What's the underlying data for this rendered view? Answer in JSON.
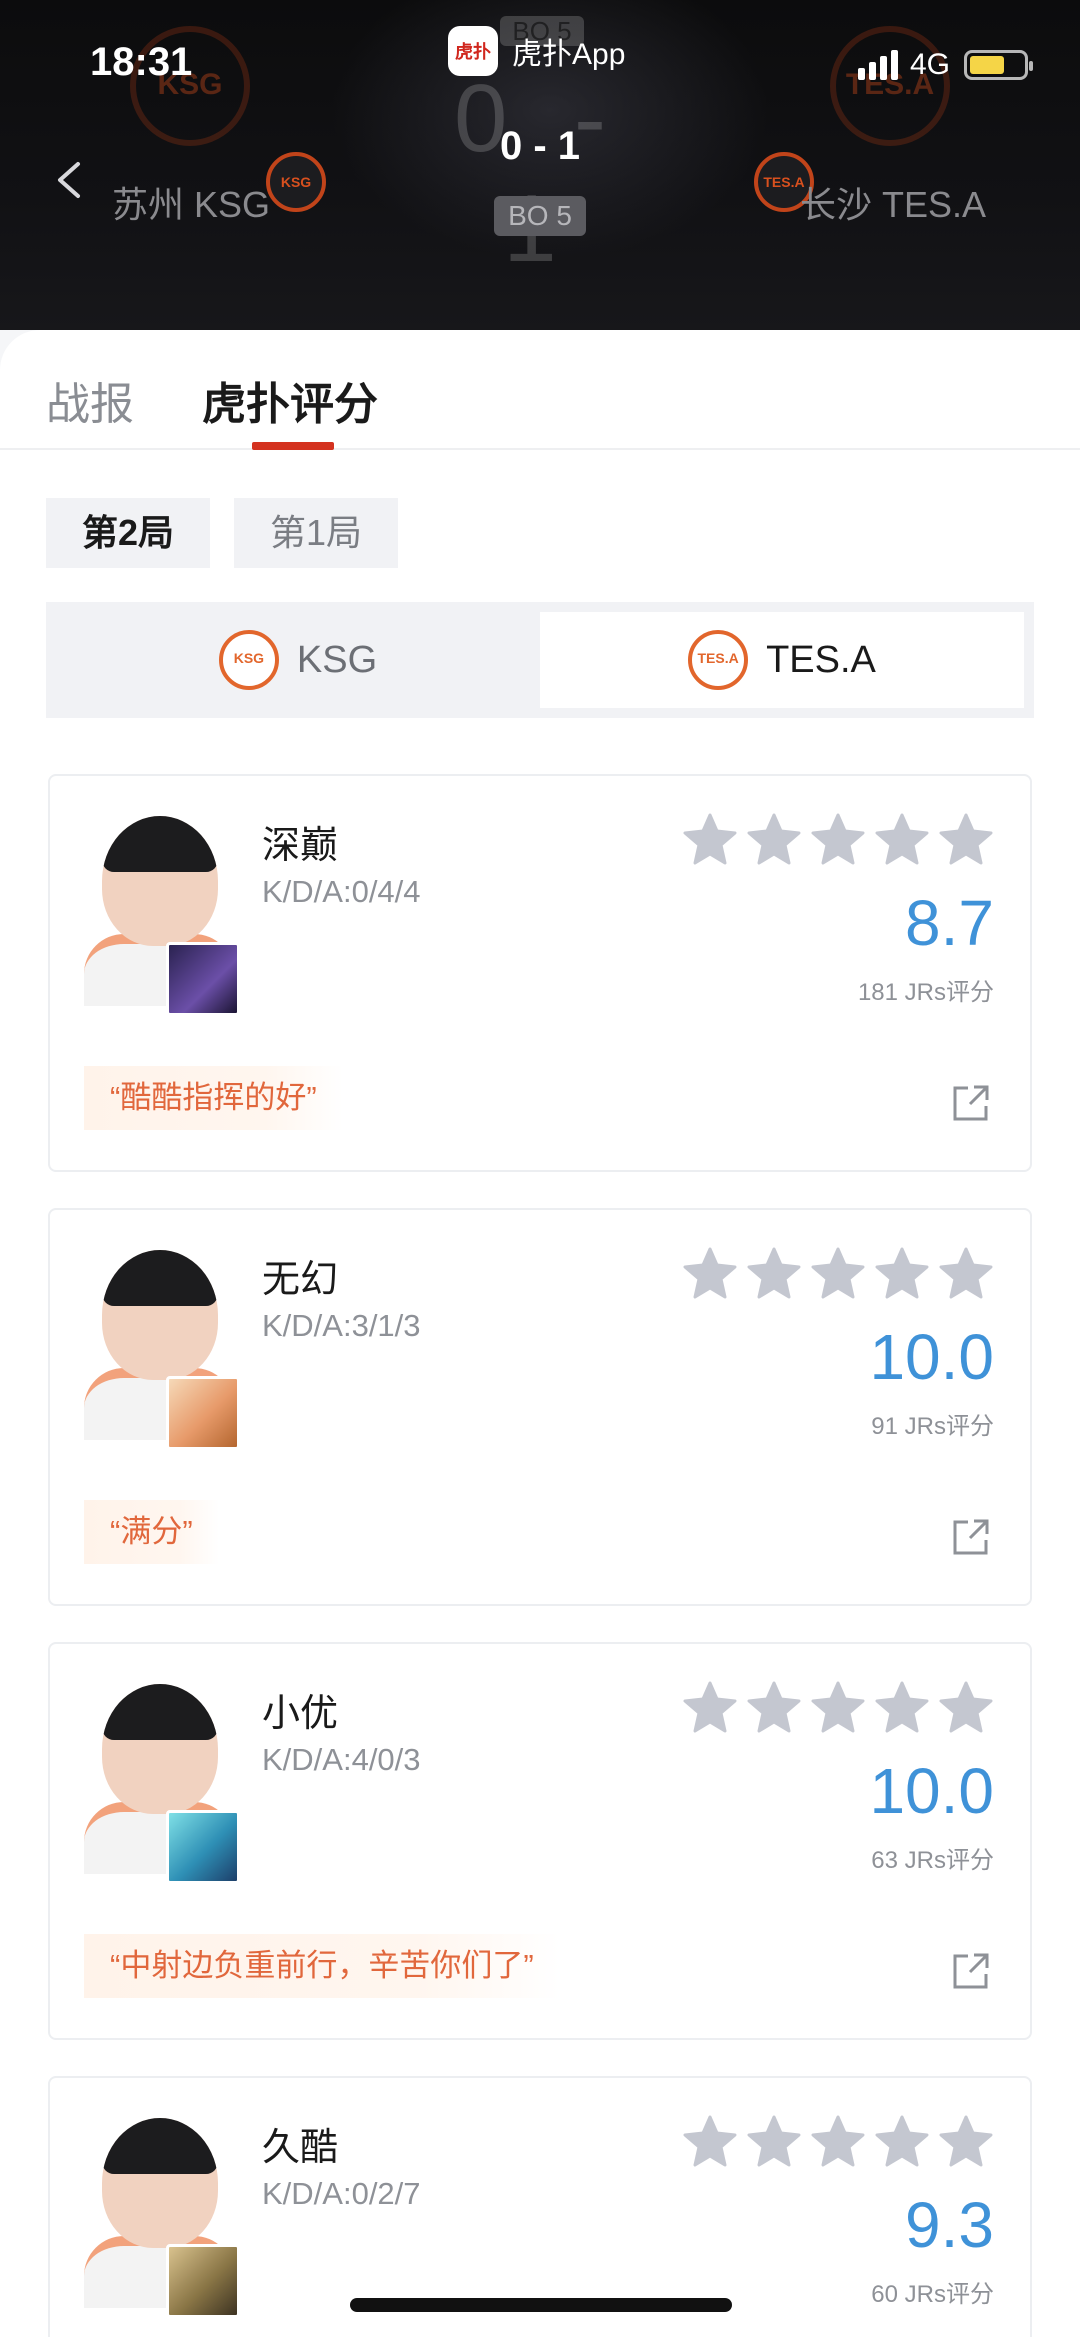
{
  "status_bar": {
    "time": "18:31",
    "app_name": "虎扑App",
    "app_icon_glyph": "虎扑",
    "network": "4G"
  },
  "header": {
    "back_icon": "chevron-left-icon",
    "left_team": {
      "name": "苏州 KSG",
      "logo_text": "KSG"
    },
    "right_team": {
      "name": "长沙 TES.A",
      "logo_text": "TES.A"
    },
    "score": "0 - 1",
    "ghost_score": "0 - 1",
    "best_of": "BO 5"
  },
  "tabs": [
    {
      "label": "战报"
    },
    {
      "label": "虎扑评分"
    }
  ],
  "game_tabs": [
    {
      "label": "第2局"
    },
    {
      "label": "第1局"
    }
  ],
  "team_switch": {
    "left": {
      "label": "KSG",
      "logo_text": "KSG"
    },
    "right": {
      "label": "TES.A",
      "logo_text": "TES.A"
    }
  },
  "players": [
    {
      "name": "深巅",
      "kda": "K/D/A:0/4/4",
      "rating": "8.7",
      "votes": "181 JRs评分",
      "quote": "“酷酷指挥的好”",
      "stars": 5
    },
    {
      "name": "无幻",
      "kda": "K/D/A:3/1/3",
      "rating": "10.0",
      "votes": "91 JRs评分",
      "quote": "“满分”",
      "stars": 5
    },
    {
      "name": "小优",
      "kda": "K/D/A:4/0/3",
      "rating": "10.0",
      "votes": "63 JRs评分",
      "quote": "“中射边负重前行，辛苦你们了”",
      "stars": 5
    },
    {
      "name": "久酷",
      "kda": "K/D/A:0/2/7",
      "rating": "9.3",
      "votes": "60 JRs评分",
      "quote": "",
      "stars": 5
    }
  ],
  "colors": {
    "accent_red": "#d4321f",
    "rating_blue": "#3f92d8",
    "quote_orange": "#e1673c",
    "star_gray": "#c4c7d0"
  }
}
